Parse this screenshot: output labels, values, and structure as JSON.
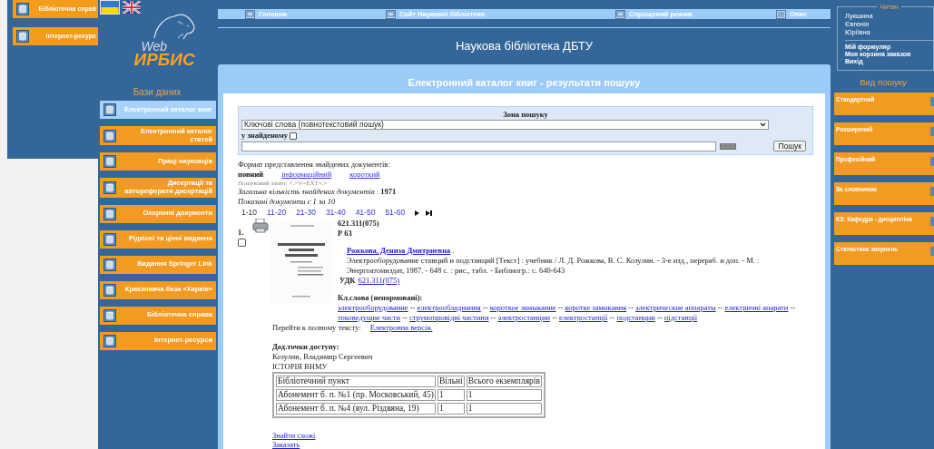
{
  "background_window": {
    "menu": [
      {
        "label": "Бібліотечна справ"
      },
      {
        "label": "Інтернет-ресурс"
      }
    ]
  },
  "languages": [
    {
      "kind": "ukrainian",
      "selected": true
    },
    {
      "kind": "english",
      "selected": false
    }
  ],
  "logo": {
    "top": "Web",
    "bottom": "ИРБИС"
  },
  "databases": {
    "title": "Бази даних",
    "items": [
      {
        "label": "Електронний каталог книг",
        "selected": true
      },
      {
        "label": "Електронний каталог статей",
        "selected": false
      },
      {
        "label": "Праці науковців",
        "selected": false
      },
      {
        "label": "Дисертації та автореферати дисертацій",
        "selected": false
      },
      {
        "label": "Охоронні документи",
        "selected": false
      },
      {
        "label": "Рідкісні та цінні видання",
        "selected": false
      },
      {
        "label": "Видання Springer Link",
        "selected": false
      },
      {
        "label": "Краєзнавча база «Харків»",
        "selected": false
      },
      {
        "label": "Бібліотечна справа",
        "selected": false
      },
      {
        "label": "Інтернет-ресурси",
        "selected": false
      }
    ]
  },
  "nav": [
    {
      "label": "Головна",
      "kind": "monitor"
    },
    {
      "label": "Сайт Наукової бібліотеки",
      "kind": "monitor"
    },
    {
      "label": "Спрощений режим",
      "kind": "monitor"
    },
    {
      "label": "Опис",
      "kind": "list"
    }
  ],
  "site_title": "Наукова бібліотека ДБТУ",
  "results": {
    "title": "Електронний каталог книг - результати пошуку",
    "search_zone": {
      "title": "Зона пошуку",
      "mode": "Ключові слова (повнотекстовий пошук)",
      "in_found_label": "у знайденому",
      "in_found_checked": false,
      "button": "Пошук"
    },
    "format": {
      "label": "Формат представлення знайдених документів:",
      "options": [
        {
          "label": "повний",
          "selected": true
        },
        {
          "label": "інформаційний",
          "selected": false
        },
        {
          "label": "короткий",
          "selected": false
        }
      ]
    },
    "query_note": "Пошуковий запит: <.>V=EXT<.>",
    "total": "*Загальна кількість знайдених документів* : **1971**",
    "shown": "Показані документи с 1 за 10",
    "pages": [
      {
        "label": "1-10",
        "selected": true
      },
      {
        "label": "11-20",
        "selected": false
      },
      {
        "label": "21-30",
        "selected": false
      },
      {
        "label": "31-40",
        "selected": false
      },
      {
        "label": "41-50",
        "selected": false
      },
      {
        "label": "51-60",
        "selected": false
      }
    ],
    "record": {
      "number": "1.",
      "checked": false,
      "class_code": "621.311(075)",
      "author_mark": "Р 63",
      "author": "Рожкова, Дениза Дмитриевна",
      "author_end": ".",
      "description": "Электрооборудование станций и подстанций [Текст] : учебник / Л. Д. Рожкова, В. С. Козулин. - 3-е изд., перераб. и доп. - М. : Энергоатомиздат, 1987. - 648 с. : рис., табл. - Библиогр.: с. 640-643",
      "udc_label": "УДК",
      "udc": "621.311(075)",
      "keywords_label": "Кл.слова (ненормовані):",
      "keywords": [
        "электрооборудование",
        "електрообладнання",
        "короткое замыкание",
        "коротке замикання",
        "электрические аппараты",
        "електричні апарати",
        "токоведущие части",
        "струмопровідні частини",
        "электростанции",
        "електростанції",
        "подстанции",
        "підстанції"
      ],
      "keyword_separator": "--",
      "fulltext_label": "Перейти к полному тексту:",
      "fulltext_link": "Електронна версія.",
      "access_label": "Дод.точки доступу:",
      "access": [
        "Козулин, Владимир Сергеевич",
        "ІСТОРІЯ ВНМУ"
      ],
      "holdings": {
        "columns": [
          "Бібліотечний пункт",
          "Вільні",
          "Всього екземплярів"
        ],
        "rows": [
          [
            "Абонемент б. п. №1 (пр. Московський, 45)",
            "1",
            "1"
          ],
          [
            "Абонемент б. п. №4 (вул. Різдвяна, 19)",
            "1",
            "1"
          ]
        ]
      },
      "links": [
        "Знайти схожі",
        "Заказать"
      ]
    }
  },
  "reader": {
    "title": "Читач",
    "name": [
      "Лукшина",
      "Євгенія",
      "Юріївна"
    ],
    "links": [
      "Мій формуляр",
      "Моя корзина заказов",
      "Вихід"
    ]
  },
  "search_types": {
    "title": "Вид пошуку",
    "items": [
      "Стандартний",
      "Розширений",
      "Професійний",
      "За словником",
      "КЗ: Кафедра - дисципліна",
      "Статистика звернень"
    ]
  }
}
